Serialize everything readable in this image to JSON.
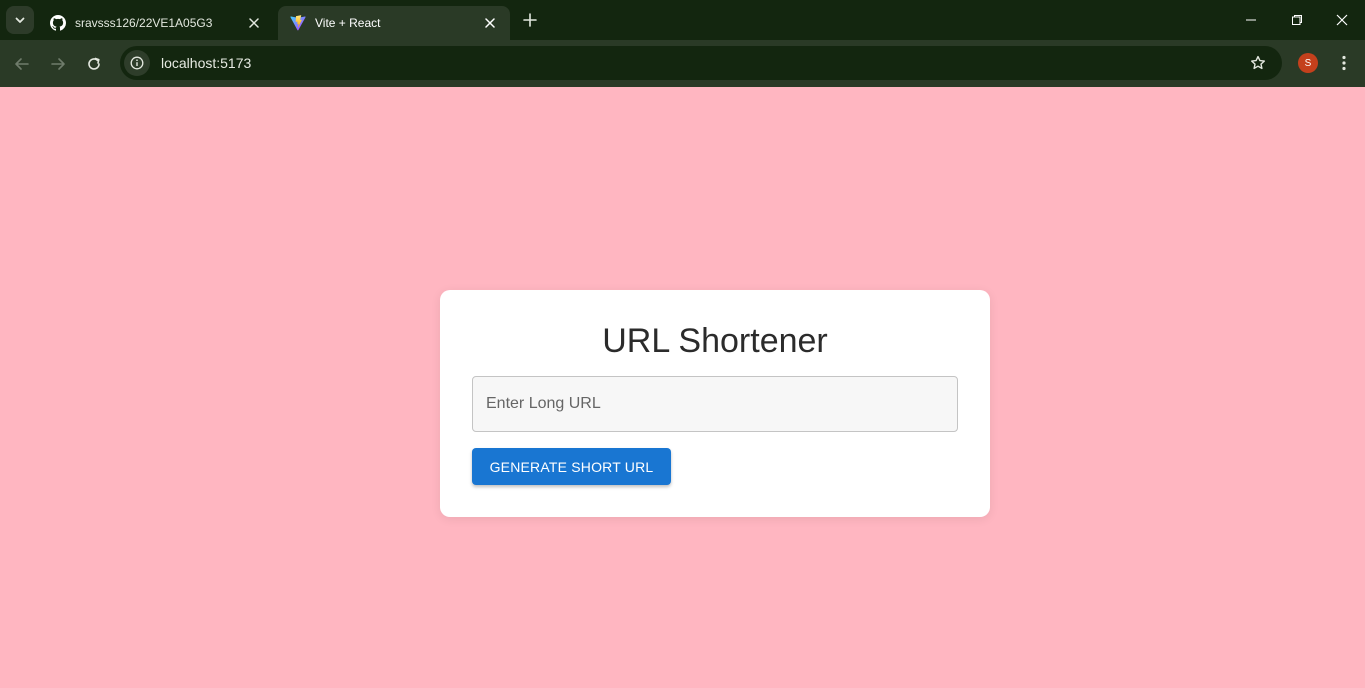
{
  "browser": {
    "tabs": [
      {
        "title": "sravsss126/22VE1A05G3",
        "favicon": "github-icon",
        "active": false
      },
      {
        "title": "Vite + React",
        "favicon": "vite-icon",
        "active": true
      }
    ],
    "address": "localhost:5173",
    "profile_initial": "S"
  },
  "page": {
    "background": "#ffb6c1",
    "heading": "URL Shortener",
    "input": {
      "placeholder": "Enter Long URL",
      "value": ""
    },
    "button_label": "GENERATE SHORT URL",
    "button_color": "#1976d2"
  }
}
